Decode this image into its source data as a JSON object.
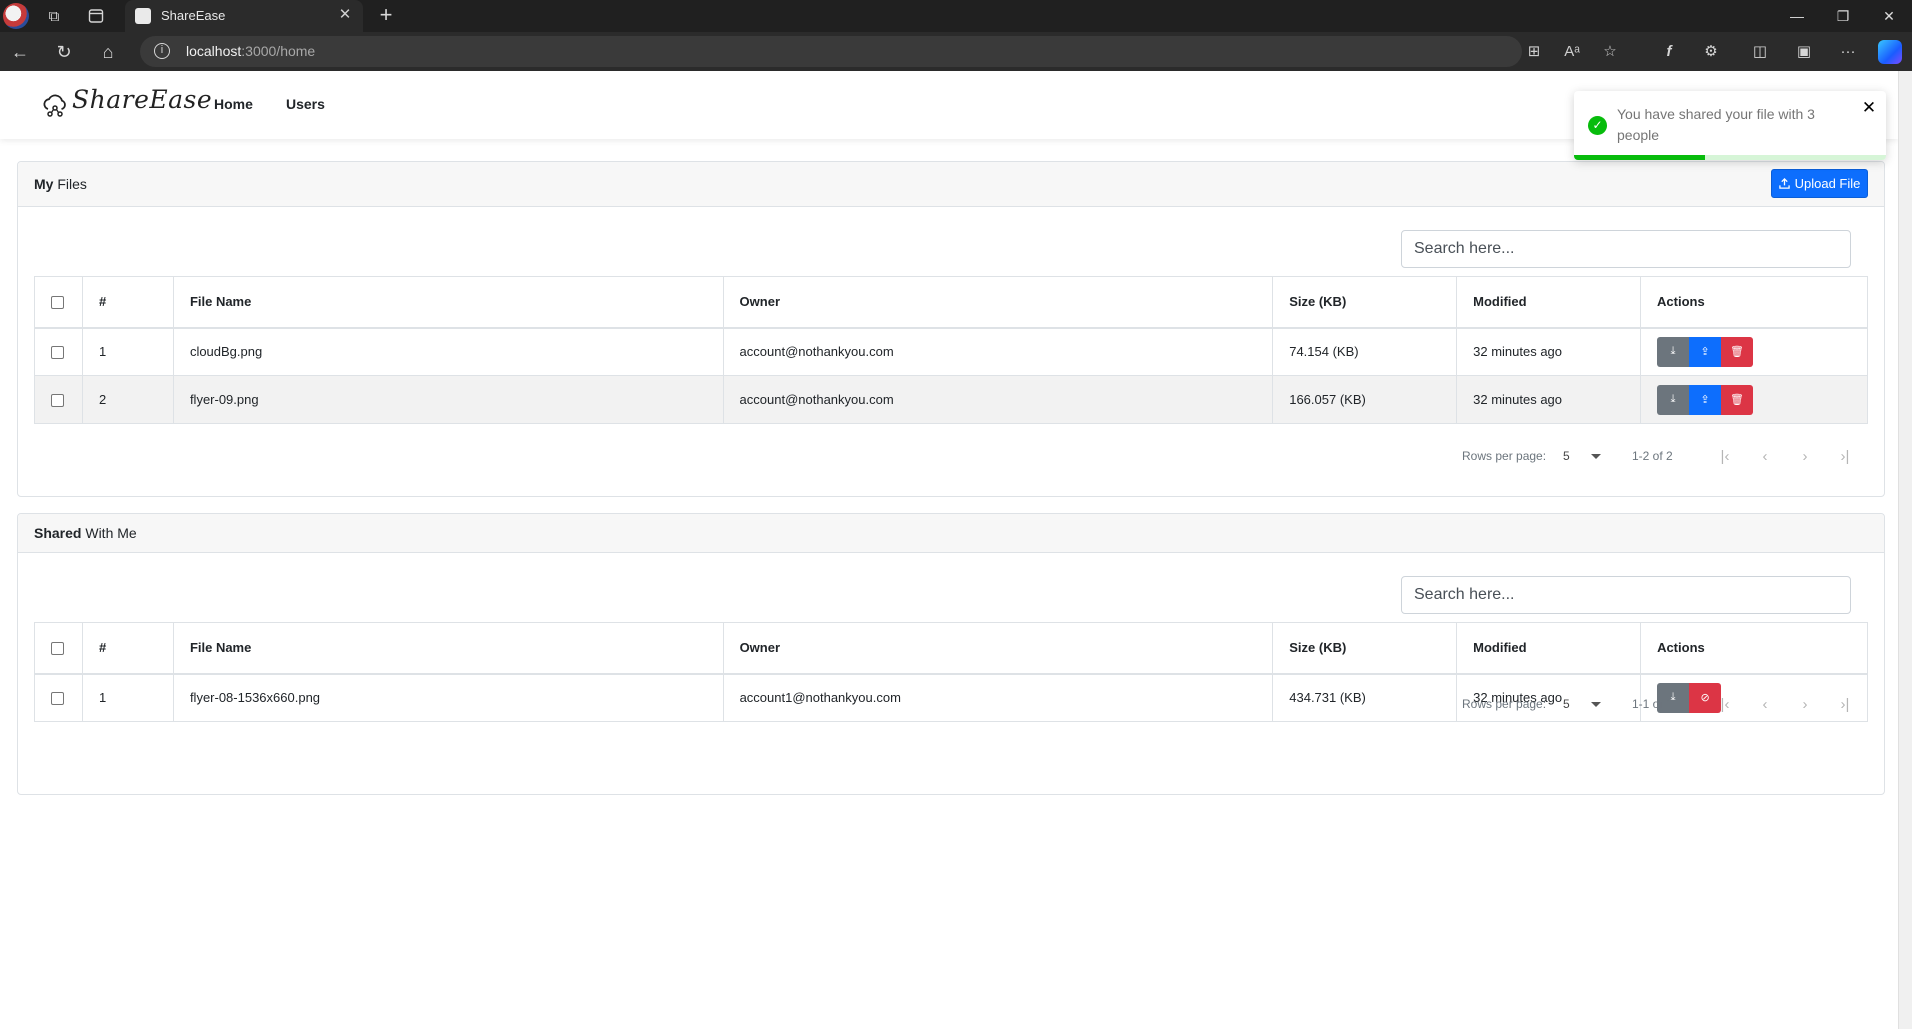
{
  "browser": {
    "tab_title": "ShareEase",
    "url_host": "localhost",
    "url_rest": ":3000/home"
  },
  "app": {
    "brand": "ShareEase",
    "nav": [
      "Home",
      "Users"
    ]
  },
  "toast": {
    "message": "You have shared your file with 3 people",
    "close": "✕",
    "progress": 0.42,
    "color": "#07bc0c"
  },
  "my_files": {
    "title_bold": "My",
    "title_rest": " Files",
    "upload_label": "Upload File",
    "search_placeholder": "Search here...",
    "columns": [
      "#",
      "File Name",
      "Owner",
      "Size (KB)",
      "Modified",
      "Actions"
    ],
    "rows": [
      {
        "n": "1",
        "name": "cloudBg.png",
        "owner": "account@nothankyou.com",
        "size": "74.154 (KB)",
        "modified": "32 minutes ago"
      },
      {
        "n": "2",
        "name": "flyer-09.png",
        "owner": "account@nothankyou.com",
        "size": "166.057 (KB)",
        "modified": "32 minutes ago"
      }
    ],
    "rows_per_page_label": "Rows per page:",
    "rows_per_page": "5",
    "range": "1-2 of 2"
  },
  "shared": {
    "title_bold": "Shared",
    "title_rest": " With Me",
    "search_placeholder": "Search here...",
    "columns": [
      "#",
      "File Name",
      "Owner",
      "Size (KB)",
      "Modified",
      "Actions"
    ],
    "rows": [
      {
        "n": "1",
        "name": "flyer-08-1536x660.png",
        "owner": "account1@nothankyou.com",
        "size": "434.731 (KB)",
        "modified": "32 minutes ago"
      }
    ],
    "rows_per_page_label": "Rows per page:",
    "rows_per_page": "5",
    "range": "1-1 of 1"
  },
  "colors": {
    "primary": "#0d6efd",
    "secondary": "#6c757d",
    "danger": "#dc3545"
  }
}
